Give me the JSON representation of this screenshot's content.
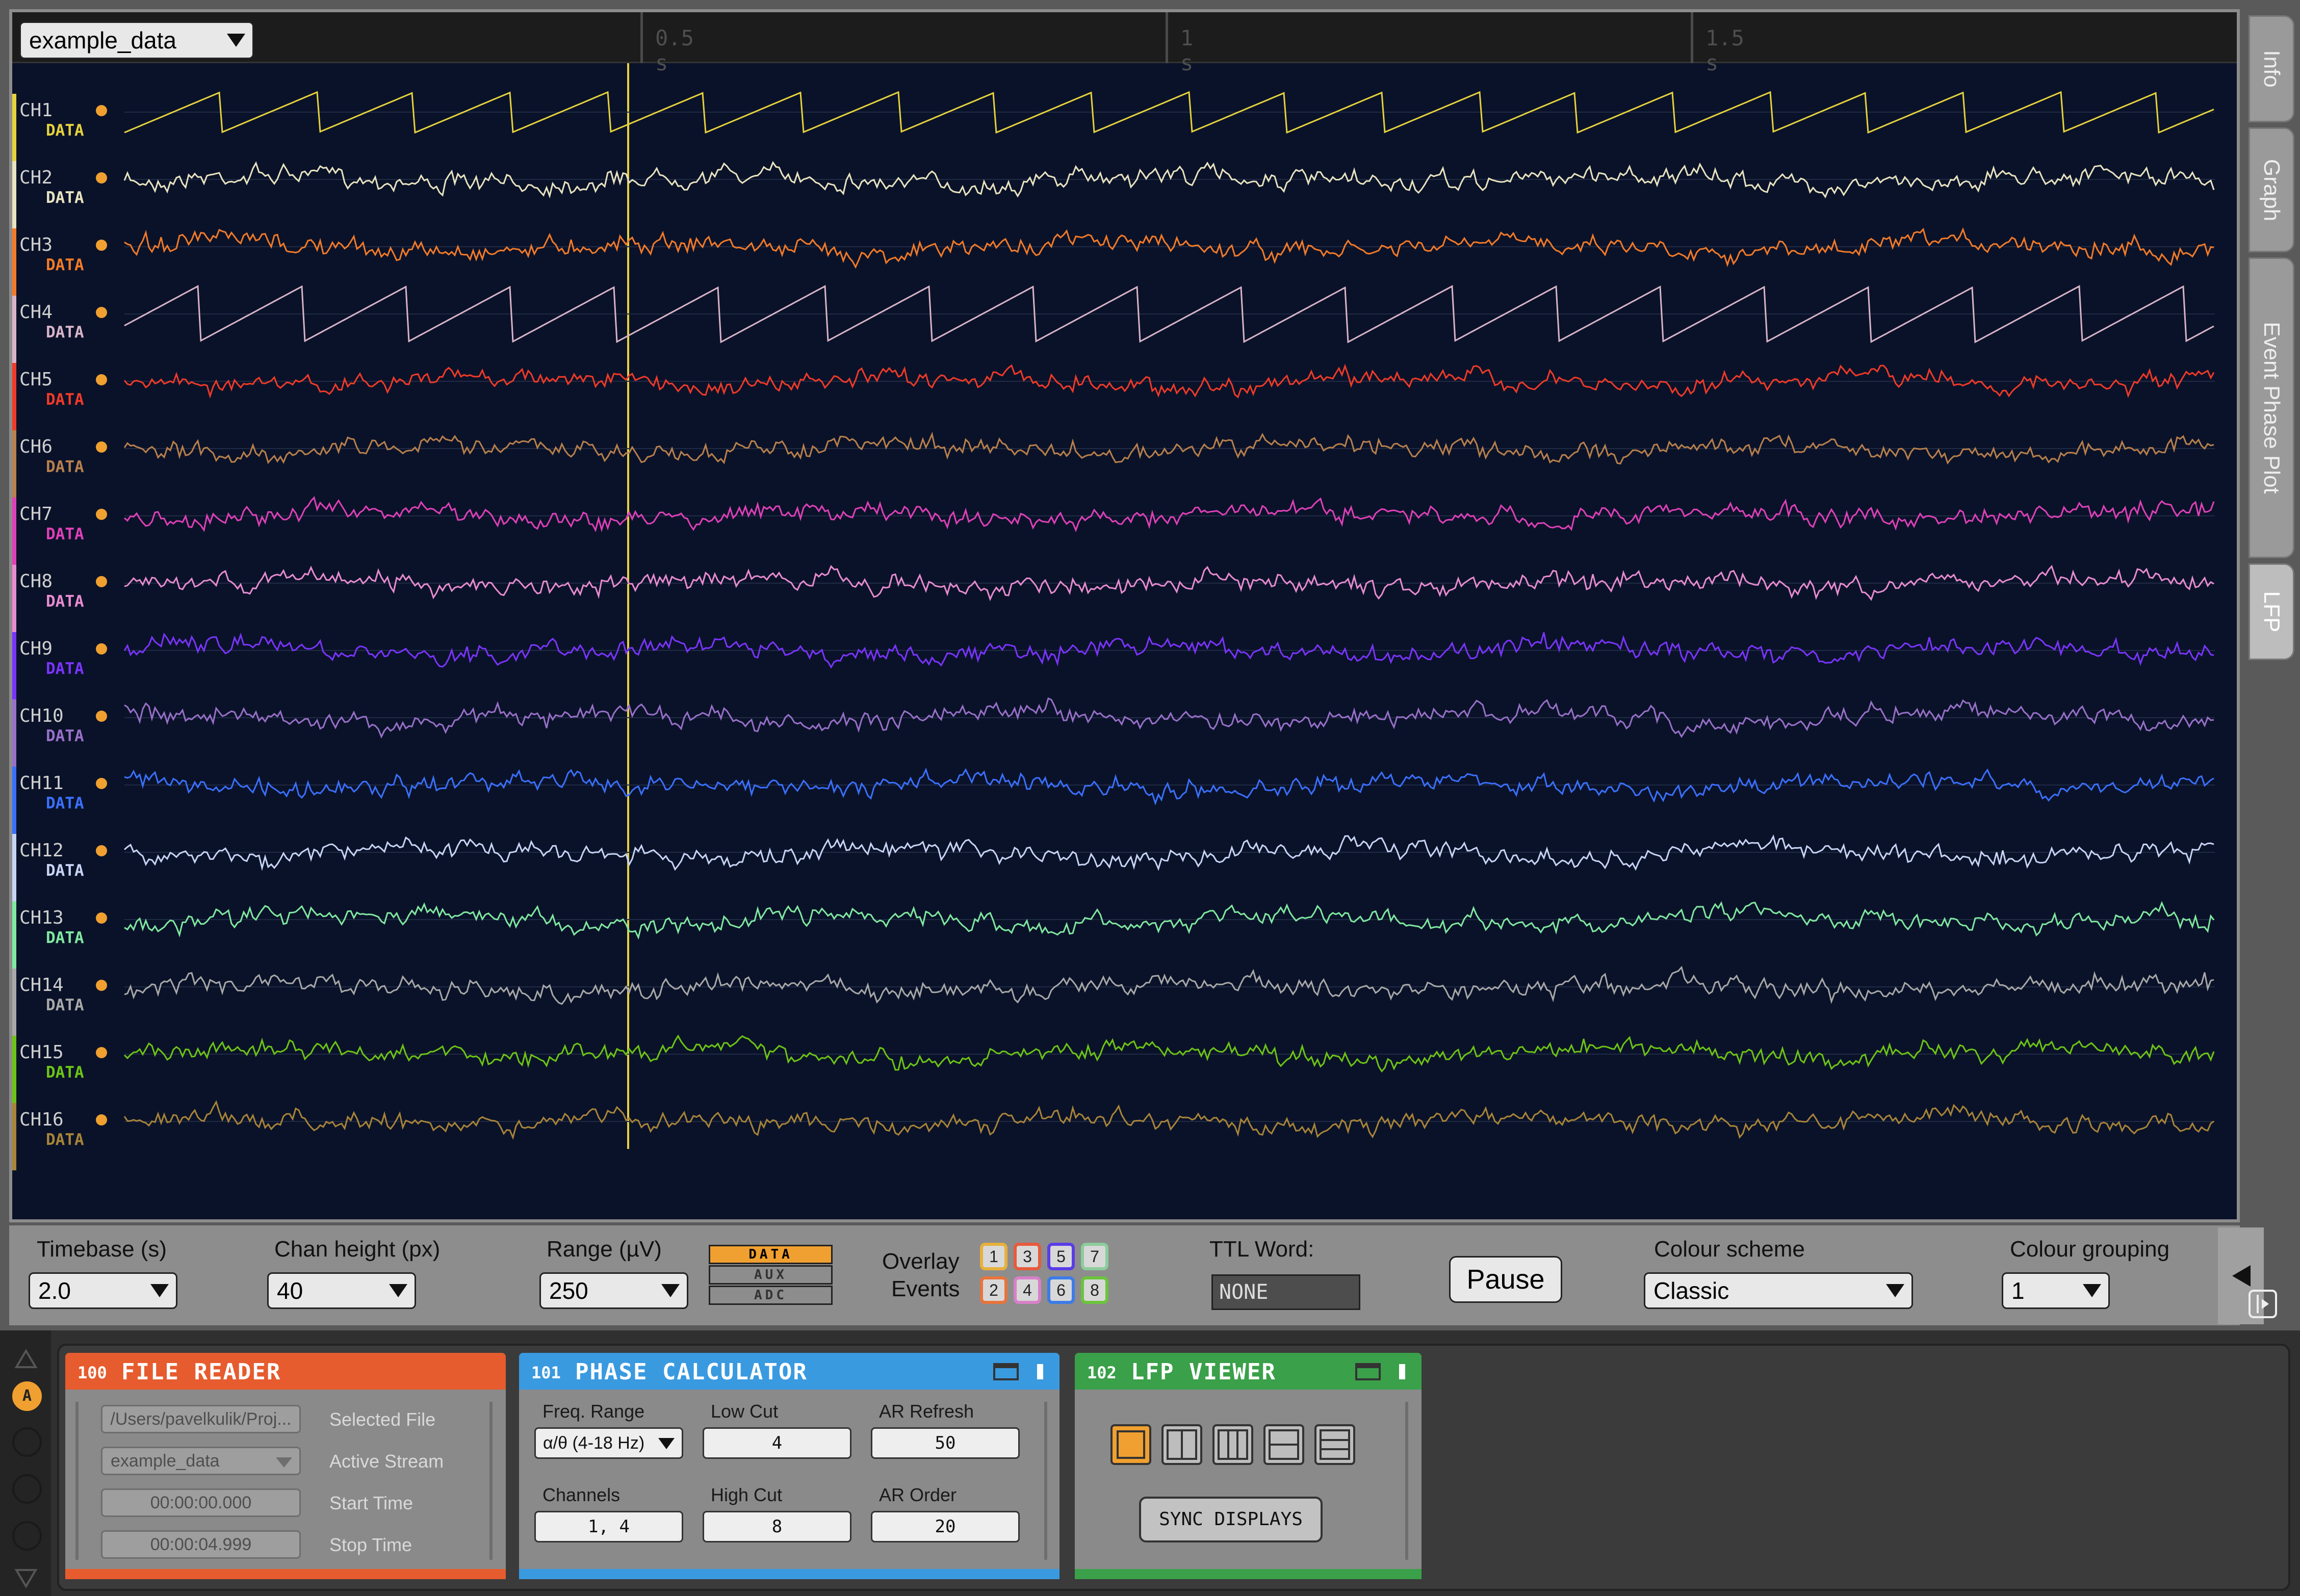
{
  "viewer": {
    "source_dropdown": "example_data",
    "time_ticks": [
      "0.5 s",
      "1 s",
      "1.5 s"
    ],
    "trace_bg": "#0a1229",
    "channels": [
      {
        "name": "CH1",
        "type": "DATA",
        "color": "#e6d23c"
      },
      {
        "name": "CH2",
        "type": "DATA",
        "color": "#e8e3c0"
      },
      {
        "name": "CH3",
        "type": "DATA",
        "color": "#f27a28"
      },
      {
        "name": "CH4",
        "type": "DATA",
        "color": "#d8b4c8"
      },
      {
        "name": "CH5",
        "type": "DATA",
        "color": "#f03a28"
      },
      {
        "name": "CH6",
        "type": "DATA",
        "color": "#b8804c"
      },
      {
        "name": "CH7",
        "type": "DATA",
        "color": "#e040b8"
      },
      {
        "name": "CH8",
        "type": "DATA",
        "color": "#e88cd0"
      },
      {
        "name": "CH9",
        "type": "DATA",
        "color": "#7a34ff"
      },
      {
        "name": "CH10",
        "type": "DATA",
        "color": "#9870c8"
      },
      {
        "name": "CH11",
        "type": "DATA",
        "color": "#3a70ff"
      },
      {
        "name": "CH12",
        "type": "DATA",
        "color": "#c8d4f4"
      },
      {
        "name": "CH13",
        "type": "DATA",
        "color": "#80e8a0"
      },
      {
        "name": "CH14",
        "type": "DATA",
        "color": "#a8a8a8"
      },
      {
        "name": "CH15",
        "type": "DATA",
        "color": "#6cc414"
      },
      {
        "name": "CH16",
        "type": "DATA",
        "color": "#a88438"
      }
    ]
  },
  "side_tabs": [
    "Info",
    "Graph",
    "Event Phase Plot",
    "LFP"
  ],
  "controls": {
    "timebase": {
      "label": "Timebase (s)",
      "value": "2.0"
    },
    "chan_height": {
      "label": "Chan height (px)",
      "value": "40"
    },
    "range": {
      "label": "Range (µV)",
      "value": "250"
    },
    "range_types": [
      "DATA",
      "AUX",
      "ADC"
    ],
    "overlay_label_1": "Overlay",
    "overlay_label_2": "Events",
    "events": [
      {
        "n": "1",
        "color": "#e8b03c"
      },
      {
        "n": "3",
        "color": "#e85a3c"
      },
      {
        "n": "5",
        "color": "#5a3ce8"
      },
      {
        "n": "7",
        "color": "#8ccc9c"
      },
      {
        "n": "2",
        "color": "#e8743c"
      },
      {
        "n": "4",
        "color": "#d880c8"
      },
      {
        "n": "6",
        "color": "#3c7ce8"
      },
      {
        "n": "8",
        "color": "#6cc43c"
      }
    ],
    "ttl_label": "TTL Word:",
    "ttl_value": "NONE",
    "pause_label": "Pause",
    "colour_scheme": {
      "label": "Colour scheme",
      "value": "Classic"
    },
    "colour_grouping": {
      "label": "Colour grouping",
      "value": "1"
    }
  },
  "editor": {
    "sidebar_letter": "A",
    "file_reader": {
      "id": "100",
      "title": "FILE READER",
      "color": "#e65c2e",
      "path": "/Users/pavelkulik/Proj...",
      "path_label": "Selected File",
      "stream": "example_data",
      "stream_label": "Active Stream",
      "start": "00:00:00.000",
      "start_label": "Start Time",
      "stop": "00:00:04.999",
      "stop_label": "Stop Time"
    },
    "phase_calculator": {
      "id": "101",
      "title": "PHASE CALCULATOR",
      "color": "#3a9ae0",
      "freq_label": "Freq. Range",
      "freq_value": "α/θ (4-18 Hz)",
      "low_cut_label": "Low Cut",
      "low_cut": "4",
      "ar_refresh_label": "AR Refresh",
      "ar_refresh": "50",
      "channels_label": "Channels",
      "channels": "1, 4",
      "high_cut_label": "High Cut",
      "high_cut": "8",
      "ar_order_label": "AR Order",
      "ar_order": "20"
    },
    "lfp_viewer": {
      "id": "102",
      "title": "LFP VIEWER",
      "color": "#3aa04a",
      "sync_label": "SYNC DISPLAYS"
    }
  }
}
